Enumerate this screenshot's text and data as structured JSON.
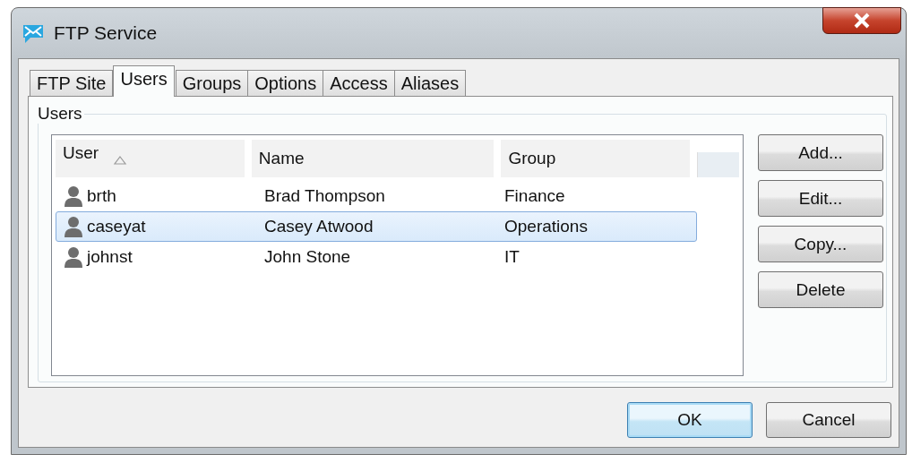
{
  "window": {
    "title": "FTP Service"
  },
  "tabs": [
    {
      "label": "FTP Site",
      "selected": false
    },
    {
      "label": "Users",
      "selected": true
    },
    {
      "label": "Groups",
      "selected": false
    },
    {
      "label": "Options",
      "selected": false
    },
    {
      "label": "Access",
      "selected": false
    },
    {
      "label": "Aliases",
      "selected": false
    }
  ],
  "group_box": {
    "label": "Users"
  },
  "table": {
    "columns": [
      {
        "label": "User",
        "sorted": true
      },
      {
        "label": "Name",
        "sorted": false
      },
      {
        "label": "Group",
        "sorted": false
      }
    ],
    "rows": [
      {
        "user": "brth",
        "name": "Brad Thompson",
        "group": "Finance",
        "selected": false
      },
      {
        "user": "caseyat",
        "name": "Casey Atwood",
        "group": "Operations",
        "selected": true
      },
      {
        "user": "johnst",
        "name": "John Stone",
        "group": "IT",
        "selected": false
      }
    ]
  },
  "side_buttons": [
    "Add...",
    "Edit...",
    "Copy...",
    "Delete"
  ],
  "buttons": [
    {
      "label": "OK",
      "default": true
    },
    {
      "label": "Cancel",
      "default": false
    }
  ]
}
